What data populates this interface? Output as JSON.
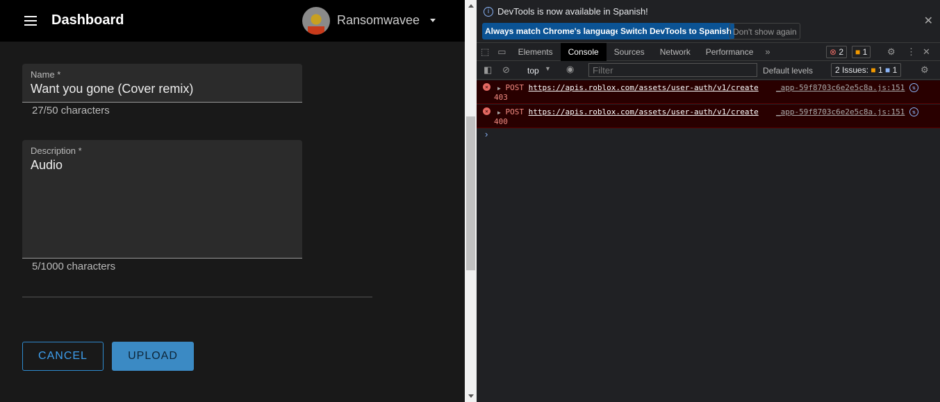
{
  "app": {
    "title": "Dashboard",
    "username": "Ransomwavee"
  },
  "form": {
    "name": {
      "label": "Name *",
      "value": "Want you gone (Cover remix)",
      "helper": "27/50 characters"
    },
    "description": {
      "label": "Description *",
      "value": "Audio",
      "helper": "5/1000 characters"
    },
    "cancel_label": "CANCEL",
    "upload_label": "UPLOAD"
  },
  "devtools": {
    "banner": {
      "text": "DevTools is now available in Spanish!",
      "btn1": "Always match Chrome's language",
      "btn2": "Switch DevTools to Spanish",
      "btn3": "Don't show again"
    },
    "tabs": [
      "Elements",
      "Console",
      "Sources",
      "Network",
      "Performance"
    ],
    "error_count": "2",
    "warning_count": "1",
    "context": "top",
    "filter_placeholder": "Filter",
    "levels": "Default levels",
    "issues": {
      "label": "2 Issues:",
      "warn": "1",
      "info": "1"
    },
    "messages": [
      {
        "method": "POST",
        "url": "https://apis.roblox.com/assets/user-auth/v1/create",
        "status": "403",
        "source": "_app-59f8703c6e2e5c8a.js:151"
      },
      {
        "method": "POST",
        "url": "https://apis.roblox.com/assets/user-auth/v1/create",
        "status": "400",
        "source": "_app-59f8703c6e2e5c8a.js:151"
      }
    ]
  }
}
